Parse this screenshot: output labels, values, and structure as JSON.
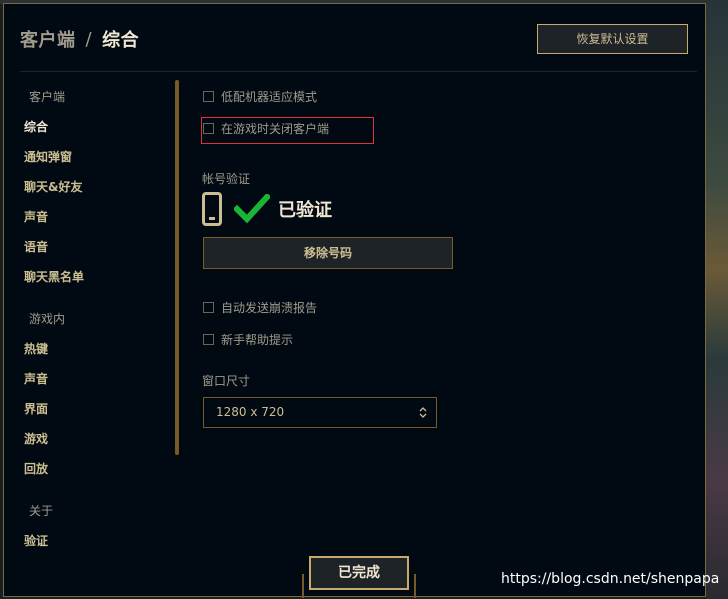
{
  "header": {
    "breadcrumb_parent": "客户端",
    "breadcrumb_separator": "/",
    "breadcrumb_current": "综合",
    "restore_defaults_label": "恢复默认设置"
  },
  "nav": {
    "client_section": "客户端",
    "client_items": [
      "综合",
      "通知弹窗",
      "聊天&好友",
      "声音",
      "语音",
      "聊天黑名单"
    ],
    "ingame_section": "游戏内",
    "ingame_items": [
      "热键",
      "声音",
      "界面",
      "游戏",
      "回放"
    ],
    "about_section": "关于",
    "about_items": [
      "验证"
    ]
  },
  "options": {
    "low_spec_mode": "低配机器适应模式",
    "close_client_ingame": "在游戏时关闭客户端",
    "auto_send_crash": "自动发送崩溃报告",
    "newbie_tips": "新手帮助提示"
  },
  "account": {
    "section_label": "帐号验证",
    "status": "已验证",
    "remove_button_label": "移除号码"
  },
  "window_size": {
    "section_label": "窗口尺寸",
    "selected": "1280 x 720"
  },
  "footer": {
    "done_label": "已完成"
  },
  "watermark": "https://blog.csdn.net/shenpapa",
  "colors": {
    "gold": "#c8aa6e",
    "text_gold": "#cdbe91",
    "highlight_red": "#e0323c",
    "check_green": "#1bb536",
    "background": "#010a13"
  },
  "icons": {
    "phone": "phone-icon",
    "check": "check-icon",
    "select_arrows": "chevron-updown-icon"
  }
}
